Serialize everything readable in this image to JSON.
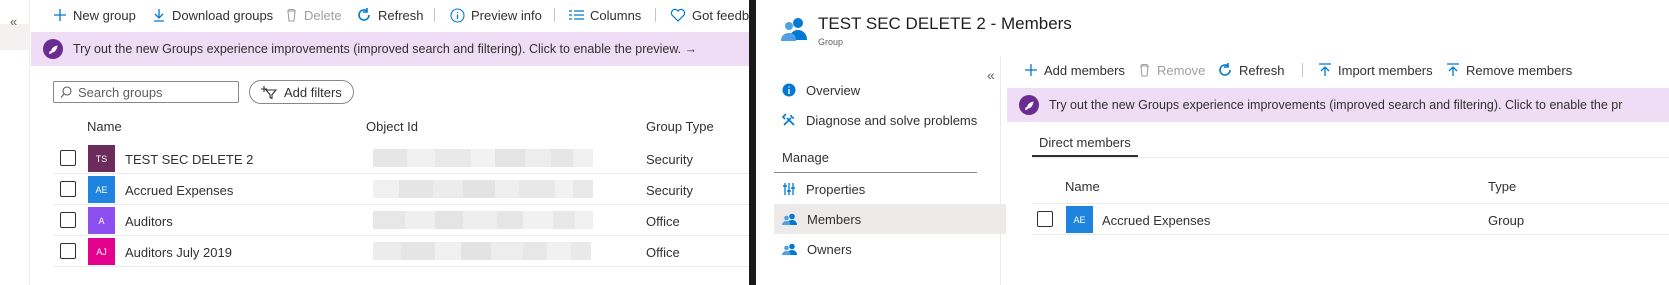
{
  "left_strip": {
    "collapse_glyph": "«"
  },
  "toolbar": {
    "new_group": "New group",
    "download_groups": "Download groups",
    "delete": "Delete",
    "refresh": "Refresh",
    "preview_info": "Preview info",
    "columns": "Columns",
    "got_feedback": "Got feedb"
  },
  "banner": {
    "text": "Try out the new Groups experience improvements (improved search and filtering). Click to enable the preview. →"
  },
  "search": {
    "placeholder": "Search groups"
  },
  "filters": {
    "add_label": "Add filters"
  },
  "table": {
    "columns": [
      "Name",
      "Object Id",
      "Group Type"
    ],
    "rows": [
      {
        "initials": "TS",
        "name": "TEST SEC DELETE 2",
        "type": "Security",
        "color": "#6b2c5c"
      },
      {
        "initials": "AE",
        "name": "Accrued Expenses",
        "type": "Security",
        "color": "#1f84e0"
      },
      {
        "initials": "A",
        "name": "Auditors",
        "type": "Office",
        "color": "#8c4ff0"
      },
      {
        "initials": "AJ",
        "name": "Auditors July 2019",
        "type": "Office",
        "color": "#e3008c"
      }
    ]
  },
  "members_pane": {
    "title": "TEST SEC DELETE 2 - Members",
    "subtitle": "Group",
    "collapse_glyph": "«",
    "nav": {
      "overview": "Overview",
      "diagnose": "Diagnose and solve problems",
      "manage_heading": "Manage",
      "properties": "Properties",
      "members": "Members",
      "owners": "Owners"
    },
    "toolbar": {
      "add_members": "Add members",
      "remove": "Remove",
      "refresh": "Refresh",
      "import_members": "Import members",
      "remove_members": "Remove members"
    },
    "banner": {
      "text": "Try out the new Groups experience improvements (improved search and filtering). Click to enable the pr"
    },
    "tab": "Direct members",
    "table": {
      "columns": [
        "Name",
        "Type"
      ],
      "rows": [
        {
          "initials": "AE",
          "name": "Accrued Expenses",
          "type": "Group",
          "color": "#1f84e0"
        }
      ]
    }
  },
  "colors": {
    "accent": "#0078d4",
    "banner_bg": "#efdcf5",
    "rocket": "#6b2c91"
  }
}
